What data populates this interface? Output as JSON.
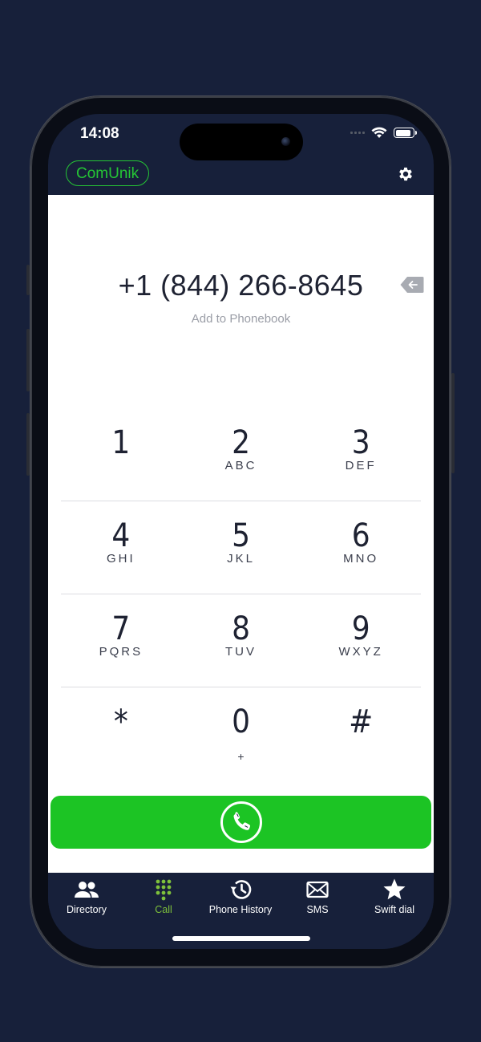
{
  "status": {
    "time": "14:08"
  },
  "header": {
    "brand": "ComUnik",
    "settings_icon": "gear-icon"
  },
  "dialer": {
    "number": "+1 (844) 266-8645",
    "add_to_phonebook": "Add to Phonebook",
    "keys": [
      [
        {
          "digit": "1",
          "letters": ""
        },
        {
          "digit": "2",
          "letters": "ABC"
        },
        {
          "digit": "3",
          "letters": "DEF"
        }
      ],
      [
        {
          "digit": "4",
          "letters": "GHI"
        },
        {
          "digit": "5",
          "letters": "JKL"
        },
        {
          "digit": "6",
          "letters": "MNO"
        }
      ],
      [
        {
          "digit": "7",
          "letters": "PQRS"
        },
        {
          "digit": "8",
          "letters": "TUV"
        },
        {
          "digit": "9",
          "letters": "WXYZ"
        }
      ],
      [
        {
          "digit": "*",
          "letters": ""
        },
        {
          "digit": "0",
          "letters": "+"
        },
        {
          "digit": "#",
          "letters": ""
        }
      ]
    ],
    "call_color": "#1cc424"
  },
  "tabs": [
    {
      "label": "Directory",
      "icon": "people-icon"
    },
    {
      "label": "Call",
      "icon": "keypad-icon",
      "active": true
    },
    {
      "label": "Phone History",
      "icon": "history-icon"
    },
    {
      "label": "SMS",
      "icon": "envelope-icon"
    },
    {
      "label": "Swift dial",
      "icon": "star-icon"
    }
  ],
  "colors": {
    "brand_green": "#25c635",
    "active_tab": "#7ec13b",
    "background": "#17203a"
  }
}
